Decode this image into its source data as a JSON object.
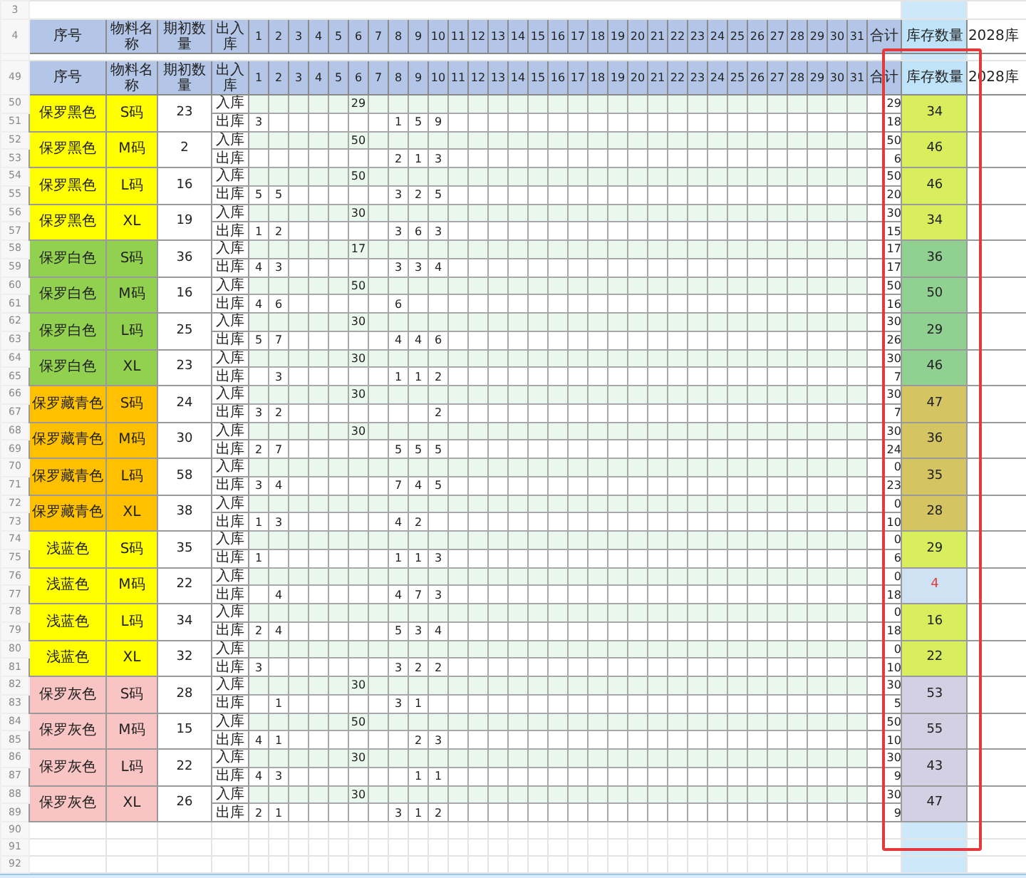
{
  "top_row": {
    "row_number": "3"
  },
  "header_rows": [
    {
      "row_number": "4",
      "cells": [
        "序号",
        "物料名称",
        "期初数量",
        "出入库",
        "1",
        "2",
        "3",
        "4",
        "5",
        "6",
        "7",
        "8",
        "9",
        "10",
        "11",
        "12",
        "13",
        "14",
        "15",
        "16",
        "17",
        "18",
        "19",
        "20",
        "21",
        "22",
        "23",
        "24",
        "25",
        "26",
        "27",
        "28",
        "29",
        "30",
        "31",
        "合计",
        "库存数量",
        "2028库"
      ]
    },
    {
      "row_number": "49",
      "cells": [
        "序号",
        "物料名称",
        "期初数量",
        "出入库",
        "1",
        "2",
        "3",
        "4",
        "5",
        "6",
        "7",
        "8",
        "9",
        "10",
        "11",
        "12",
        "13",
        "14",
        "15",
        "16",
        "17",
        "18",
        "19",
        "20",
        "21",
        "22",
        "23",
        "24",
        "25",
        "26",
        "27",
        "28",
        "29",
        "30",
        "31",
        "合计",
        "库存数量",
        "2028库"
      ]
    }
  ],
  "groups": [
    {
      "color": "#ffff00",
      "items": [
        {
          "name": "保罗黑色",
          "size": "S码",
          "opening": "23",
          "rows": [
            {
              "row_number": "50",
              "kind": "in",
              "label": "入库",
              "days": {
                "6": "29"
              },
              "total": "29"
            },
            {
              "row_number": "51",
              "kind": "out",
              "label": "出库",
              "days": {
                "1": "3",
                "8": "1",
                "9": "5",
                "10": "9"
              },
              "total": "18"
            }
          ],
          "stock": {
            "value": "34",
            "color": "#d8ee5c",
            "low": false
          }
        },
        {
          "name": "保罗黑色",
          "size": "M码",
          "opening": "2",
          "rows": [
            {
              "row_number": "52",
              "kind": "in",
              "label": "入库",
              "days": {
                "6": "50"
              },
              "total": "50"
            },
            {
              "row_number": "53",
              "kind": "out",
              "label": "出库",
              "days": {
                "8": "2",
                "9": "1",
                "10": "3"
              },
              "total": "6"
            }
          ],
          "stock": {
            "value": "46",
            "color": "#d8ee5c",
            "low": false
          }
        },
        {
          "name": "保罗黑色",
          "size": "L码",
          "opening": "16",
          "rows": [
            {
              "row_number": "54",
              "kind": "in",
              "label": "入库",
              "days": {
                "6": "50"
              },
              "total": "50"
            },
            {
              "row_number": "55",
              "kind": "out",
              "label": "出库",
              "days": {
                "1": "5",
                "2": "5",
                "8": "3",
                "9": "2",
                "10": "5"
              },
              "total": "20"
            }
          ],
          "stock": {
            "value": "46",
            "color": "#d8ee5c",
            "low": false
          }
        },
        {
          "name": "保罗黑色",
          "size": "XL",
          "opening": "19",
          "rows": [
            {
              "row_number": "56",
              "kind": "in",
              "label": "入库",
              "days": {
                "6": "30"
              },
              "total": "30"
            },
            {
              "row_number": "57",
              "kind": "out",
              "label": "出库",
              "days": {
                "1": "1",
                "2": "2",
                "8": "3",
                "9": "6",
                "10": "3"
              },
              "total": "15"
            }
          ],
          "stock": {
            "value": "34",
            "color": "#d8ee5c",
            "low": false
          }
        }
      ]
    },
    {
      "color": "#92d050",
      "items": [
        {
          "name": "保罗白色",
          "size": "S码",
          "opening": "36",
          "rows": [
            {
              "row_number": "58",
              "kind": "in",
              "label": "入库",
              "days": {
                "6": "17"
              },
              "total": "17"
            },
            {
              "row_number": "59",
              "kind": "out",
              "label": "出库",
              "days": {
                "1": "4",
                "2": "3",
                "8": "3",
                "9": "3",
                "10": "4"
              },
              "total": "17"
            }
          ],
          "stock": {
            "value": "36",
            "color": "#90d192",
            "low": false
          }
        },
        {
          "name": "保罗白色",
          "size": "M码",
          "opening": "16",
          "rows": [
            {
              "row_number": "60",
              "kind": "in",
              "label": "入库",
              "days": {
                "6": "50"
              },
              "total": "50"
            },
            {
              "row_number": "61",
              "kind": "out",
              "label": "出库",
              "days": {
                "1": "4",
                "2": "6",
                "8": "6"
              },
              "total": "16"
            }
          ],
          "stock": {
            "value": "50",
            "color": "#90d192",
            "low": false
          }
        },
        {
          "name": "保罗白色",
          "size": "L码",
          "opening": "25",
          "rows": [
            {
              "row_number": "62",
              "kind": "in",
              "label": "入库",
              "days": {
                "6": "30"
              },
              "total": "30"
            },
            {
              "row_number": "63",
              "kind": "out",
              "label": "出库",
              "days": {
                "1": "5",
                "2": "7",
                "8": "4",
                "9": "4",
                "10": "6"
              },
              "total": "26"
            }
          ],
          "stock": {
            "value": "29",
            "color": "#90d192",
            "low": false
          }
        },
        {
          "name": "保罗白色",
          "size": "XL",
          "opening": "23",
          "rows": [
            {
              "row_number": "64",
              "kind": "in",
              "label": "入库",
              "days": {
                "6": "30"
              },
              "total": "30"
            },
            {
              "row_number": "65",
              "kind": "out",
              "label": "出库",
              "days": {
                "2": "3",
                "8": "1",
                "9": "1",
                "10": "2"
              },
              "total": "7"
            }
          ],
          "stock": {
            "value": "46",
            "color": "#90d192",
            "low": false
          }
        }
      ]
    },
    {
      "color": "#ffc000",
      "items": [
        {
          "name": "保罗藏青色",
          "size": "S码",
          "opening": "24",
          "rows": [
            {
              "row_number": "66",
              "kind": "in",
              "label": "入库",
              "days": {
                "6": "30"
              },
              "total": "30"
            },
            {
              "row_number": "67",
              "kind": "out",
              "label": "出库",
              "days": {
                "1": "3",
                "2": "2",
                "10": "2"
              },
              "total": "7"
            }
          ],
          "stock": {
            "value": "47",
            "color": "#d4c462",
            "low": false
          }
        },
        {
          "name": "保罗藏青色",
          "size": "M码",
          "opening": "30",
          "rows": [
            {
              "row_number": "68",
              "kind": "in",
              "label": "入库",
              "days": {
                "6": "30"
              },
              "total": "30"
            },
            {
              "row_number": "69",
              "kind": "out",
              "label": "出库",
              "days": {
                "1": "2",
                "2": "7",
                "8": "5",
                "9": "5",
                "10": "5"
              },
              "total": "24"
            }
          ],
          "stock": {
            "value": "36",
            "color": "#d4c462",
            "low": false
          }
        },
        {
          "name": "保罗藏青色",
          "size": "L码",
          "opening": "58",
          "rows": [
            {
              "row_number": "70",
              "kind": "in",
              "label": "入库",
              "days": {},
              "total": "0"
            },
            {
              "row_number": "71",
              "kind": "out",
              "label": "出库",
              "days": {
                "1": "3",
                "2": "4",
                "8": "7",
                "9": "4",
                "10": "5"
              },
              "total": "23"
            }
          ],
          "stock": {
            "value": "35",
            "color": "#d4c462",
            "low": false
          }
        },
        {
          "name": "保罗藏青色",
          "size": "XL",
          "opening": "38",
          "rows": [
            {
              "row_number": "72",
              "kind": "in",
              "label": "入库",
              "days": {},
              "total": "0"
            },
            {
              "row_number": "73",
              "kind": "out",
              "label": "出库",
              "days": {
                "1": "1",
                "2": "3",
                "8": "4",
                "9": "2"
              },
              "total": "10"
            }
          ],
          "stock": {
            "value": "28",
            "color": "#d4c462",
            "low": false
          }
        }
      ]
    },
    {
      "color": "#ffff00",
      "items": [
        {
          "name": "浅蓝色",
          "size": "S码",
          "opening": "35",
          "rows": [
            {
              "row_number": "74",
              "kind": "in",
              "label": "入库",
              "days": {},
              "total": "0"
            },
            {
              "row_number": "75",
              "kind": "out",
              "label": "出库",
              "days": {
                "1": "1",
                "8": "1",
                "9": "1",
                "10": "3"
              },
              "total": "6"
            }
          ],
          "stock": {
            "value": "29",
            "color": "#d8ee5c",
            "low": false
          }
        },
        {
          "name": "浅蓝色",
          "size": "M码",
          "opening": "22",
          "rows": [
            {
              "row_number": "76",
              "kind": "in",
              "label": "入库",
              "days": {},
              "total": "0"
            },
            {
              "row_number": "77",
              "kind": "out",
              "label": "出库",
              "days": {
                "2": "4",
                "8": "4",
                "9": "7",
                "10": "3"
              },
              "total": "18"
            }
          ],
          "stock": {
            "value": "4",
            "color": "#cfe2f3",
            "low": true
          }
        },
        {
          "name": "浅蓝色",
          "size": "L码",
          "opening": "34",
          "rows": [
            {
              "row_number": "78",
              "kind": "in",
              "label": "入库",
              "days": {},
              "total": "0"
            },
            {
              "row_number": "79",
              "kind": "out",
              "label": "出库",
              "days": {
                "1": "2",
                "2": "4",
                "8": "5",
                "9": "3",
                "10": "4"
              },
              "total": "18"
            }
          ],
          "stock": {
            "value": "16",
            "color": "#d8ee5c",
            "low": false
          }
        },
        {
          "name": "浅蓝色",
          "size": "XL",
          "opening": "32",
          "rows": [
            {
              "row_number": "80",
              "kind": "in",
              "label": "入库",
              "days": {},
              "total": "0"
            },
            {
              "row_number": "81",
              "kind": "out",
              "label": "出库",
              "days": {
                "1": "3",
                "8": "3",
                "9": "2",
                "10": "2"
              },
              "total": "10"
            }
          ],
          "stock": {
            "value": "22",
            "color": "#d8ee5c",
            "low": false
          }
        }
      ]
    },
    {
      "color": "#f9c4c4",
      "items": [
        {
          "name": "保罗灰色",
          "size": "S码",
          "opening": "28",
          "rows": [
            {
              "row_number": "82",
              "kind": "in",
              "label": "入库",
              "days": {
                "6": "30"
              },
              "total": "30"
            },
            {
              "row_number": "83",
              "kind": "out",
              "label": "出库",
              "days": {
                "2": "1",
                "8": "3",
                "9": "1"
              },
              "total": "5"
            }
          ],
          "stock": {
            "value": "53",
            "color": "#d2d0e2",
            "low": false
          }
        },
        {
          "name": "保罗灰色",
          "size": "M码",
          "opening": "15",
          "rows": [
            {
              "row_number": "84",
              "kind": "in",
              "label": "入库",
              "days": {
                "6": "50"
              },
              "total": "50"
            },
            {
              "row_number": "85",
              "kind": "out",
              "label": "出库",
              "days": {
                "1": "4",
                "2": "1",
                "9": "2",
                "10": "3"
              },
              "total": "10"
            }
          ],
          "stock": {
            "value": "55",
            "color": "#d2d0e2",
            "low": false
          }
        },
        {
          "name": "保罗灰色",
          "size": "L码",
          "opening": "22",
          "rows": [
            {
              "row_number": "86",
              "kind": "in",
              "label": "入库",
              "days": {
                "6": "30"
              },
              "total": "30"
            },
            {
              "row_number": "87",
              "kind": "out",
              "label": "出库",
              "days": {
                "1": "4",
                "2": "3",
                "9": "1",
                "10": "1"
              },
              "total": "9"
            }
          ],
          "stock": {
            "value": "43",
            "color": "#d2d0e2",
            "low": false
          }
        },
        {
          "name": "保罗灰色",
          "size": "XL",
          "opening": "26",
          "rows": [
            {
              "row_number": "88",
              "kind": "in",
              "label": "入库",
              "days": {
                "6": "30"
              },
              "total": "30"
            },
            {
              "row_number": "89",
              "kind": "out",
              "label": "出库",
              "days": {
                "1": "2",
                "2": "1",
                "8": "3",
                "9": "1",
                "10": "2"
              },
              "total": "9"
            }
          ],
          "stock": {
            "value": "47",
            "color": "#d2d0e2",
            "low": false
          }
        }
      ]
    }
  ],
  "empty_rows": [
    "90",
    "91",
    "92"
  ]
}
